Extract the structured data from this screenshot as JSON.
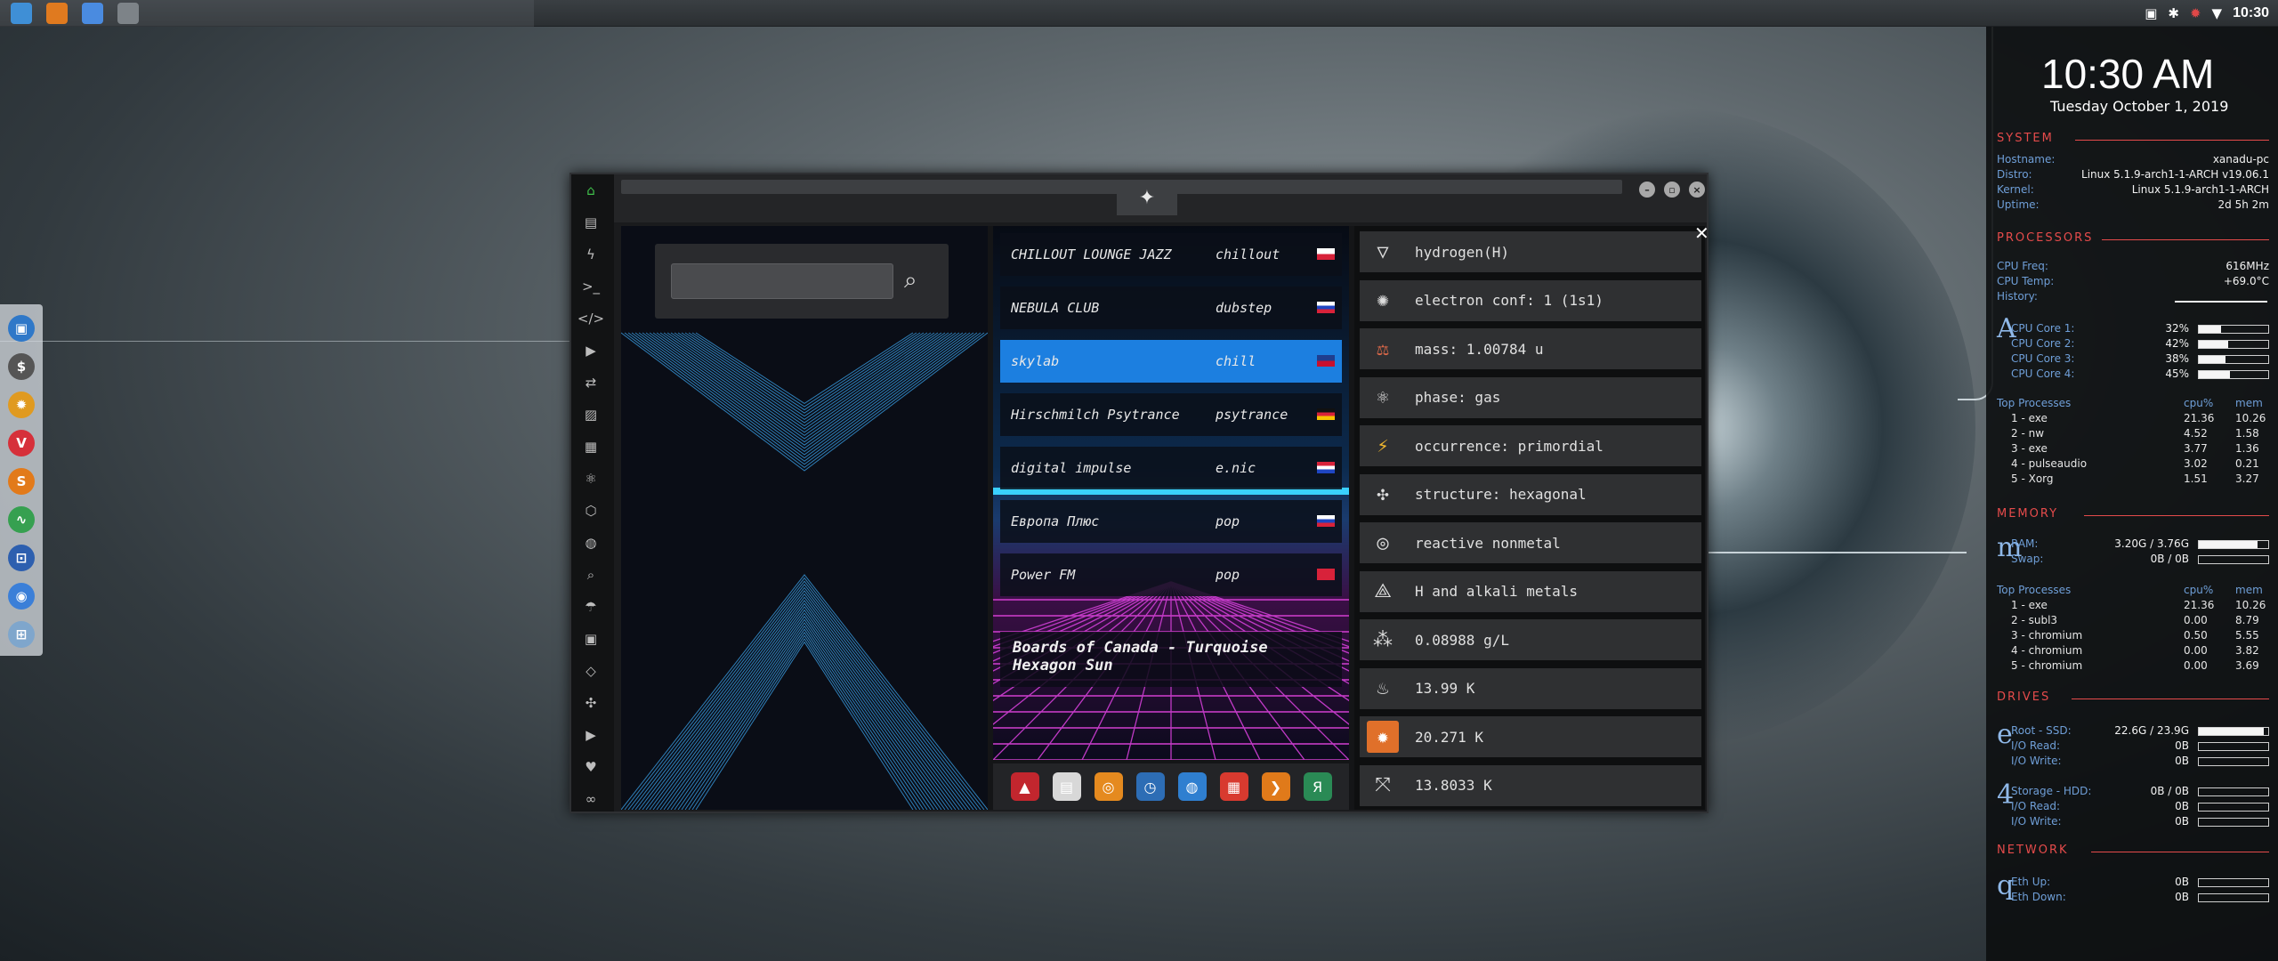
{
  "topbar": {
    "apps": [
      {
        "name": "files-icon",
        "color": "#3f8fd6"
      },
      {
        "name": "sublime-icon",
        "color": "#e07a1f"
      },
      {
        "name": "chromium-icon",
        "color": "#4a8be0"
      },
      {
        "name": "workspace-icon",
        "color": "#7d8388"
      }
    ],
    "clock": "10:30"
  },
  "dock": [
    {
      "name": "files-icon",
      "color": "#2f78c8",
      "glyph": "▣"
    },
    {
      "name": "dollar-terminal-icon",
      "color": "#555",
      "glyph": "$"
    },
    {
      "name": "settings-icon",
      "color": "#e09a20",
      "glyph": "✹"
    },
    {
      "name": "vivaldi-icon",
      "color": "#d6303a",
      "glyph": "V"
    },
    {
      "name": "sublime-icon",
      "color": "#e27a1a",
      "glyph": "S"
    },
    {
      "name": "monitor-icon",
      "color": "#36a050",
      "glyph": "∿"
    },
    {
      "name": "screenshot-icon",
      "color": "#2d5faf",
      "glyph": "⊡"
    },
    {
      "name": "chromium-icon",
      "color": "#3b7fd8",
      "glyph": "◉"
    },
    {
      "name": "grid-icon",
      "color": "#7fa6cc",
      "glyph": "⊞"
    }
  ],
  "window": {
    "title_glyph": "✦",
    "search": {
      "placeholder": "",
      "value": ""
    },
    "sidebar_icons": [
      "home-icon",
      "document-icon",
      "bolt-icon",
      "terminal-icon",
      "code-icon",
      "play-icon",
      "translate-icon",
      "image-icon",
      "news-icon",
      "atom-icon",
      "hexagon-icon",
      "globe-icon",
      "search-icon",
      "umbrella-icon",
      "contact-icon",
      "embed-icon",
      "network-icon",
      "youtube-icon",
      "heart-icon",
      "infinity-icon"
    ],
    "stations": [
      {
        "name": "CHILLOUT LOUNGE JAZZ",
        "genre": "chillout",
        "flag": "pl"
      },
      {
        "name": "NEBULA CLUB",
        "genre": "dubstep",
        "flag": "ru"
      },
      {
        "name": "skylab",
        "genre": "chill",
        "flag": "gb"
      },
      {
        "name": "Hirschmilch Psytrance",
        "genre": "psytrance",
        "flag": "de"
      },
      {
        "name": "digital impulse",
        "genre": "e.nic",
        "flag": "hr"
      },
      {
        "name": "Европа Плюс",
        "genre": "pop",
        "flag": "ru"
      },
      {
        "name": "Power FM",
        "genre": "pop",
        "flag": "tr"
      }
    ],
    "active_station": 2,
    "now_playing": "Boards of Canada - Turquoise Hexagon Sun",
    "appbar": [
      {
        "name": "app-red-icon",
        "color": "#c2262e",
        "glyph": "▲"
      },
      {
        "name": "calendar-notes-icon",
        "color": "#d8d8d8",
        "glyph": "▤"
      },
      {
        "name": "magnifier-app-icon",
        "color": "#e58a1f",
        "glyph": "◎"
      },
      {
        "name": "clock-app-icon",
        "color": "#2d6db5",
        "glyph": "◷"
      },
      {
        "name": "globe-app-icon",
        "color": "#2f7fd0",
        "glyph": "◍"
      },
      {
        "name": "calendar-app-icon",
        "color": "#d83a2f",
        "glyph": "▦"
      },
      {
        "name": "arrow-app-icon",
        "color": "#e07a1a",
        "glyph": "❯"
      },
      {
        "name": "yandex-app-icon",
        "color": "#2a8a55",
        "glyph": "Я"
      }
    ],
    "elements": [
      {
        "icon": "triangle-icon",
        "glyph": "▽",
        "text": "hydrogen(H)"
      },
      {
        "icon": "electron-icon",
        "glyph": "✺",
        "text": "electron conf: 1 (1s1)"
      },
      {
        "icon": "scale-icon",
        "glyph": "⚖",
        "text": "mass: 1.00784 u"
      },
      {
        "icon": "atom-icon",
        "glyph": "⚛",
        "text": "phase: gas"
      },
      {
        "icon": "lightning-icon",
        "glyph": "⚡",
        "text": "occurrence: primordial"
      },
      {
        "icon": "structure-icon",
        "glyph": "✣",
        "text": "structure: hexagonal"
      },
      {
        "icon": "reactive-icon",
        "glyph": "◎",
        "text": "reactive nonmetal"
      },
      {
        "icon": "molecule-icon",
        "glyph": "⟁",
        "text": "H and alkali metals"
      },
      {
        "icon": "density-icon",
        "glyph": "⁂",
        "text": "0.08988 g/L"
      },
      {
        "icon": "melting-icon",
        "glyph": "♨",
        "text": "13.99  K"
      },
      {
        "icon": "boiling-icon",
        "glyph": "✹",
        "text": "20.271  K"
      },
      {
        "icon": "critical-icon",
        "glyph": "⤧",
        "text": "13.8033  K"
      }
    ]
  },
  "conky": {
    "time": "10:30 AM",
    "date": "Tuesday October  1, 2019",
    "system_label": "SYSTEM",
    "system": [
      {
        "k": "Hostname:",
        "v": "xanadu-pc"
      },
      {
        "k": "Distro:",
        "v": "Linux 5.1.9-arch1-1-ARCH v19.06.1"
      },
      {
        "k": "Kernel:",
        "v": "Linux 5.1.9-arch1-1-ARCH"
      },
      {
        "k": "Uptime:",
        "v": "2d 5h 2m"
      }
    ],
    "processors_label": "PROCESSORS",
    "cpu": [
      {
        "k": "CPU Freq:",
        "v": "616MHz"
      },
      {
        "k": "CPU Temp:",
        "v": "+69.0°C"
      },
      {
        "k": "History:",
        "v": ""
      }
    ],
    "cores_glyph": "A",
    "cores": [
      {
        "k": "CPU Core 1:",
        "v": "32%",
        "pct": 32
      },
      {
        "k": "CPU Core 2:",
        "v": "42%",
        "pct": 42
      },
      {
        "k": "CPU Core 3:",
        "v": "38%",
        "pct": 38
      },
      {
        "k": "CPU Core 4:",
        "v": "45%",
        "pct": 45
      }
    ],
    "top_cpu": {
      "header": [
        "Top Processes",
        "cpu%",
        "mem"
      ],
      "rows": [
        [
          "1 - exe",
          "21.36",
          "10.26"
        ],
        [
          "2 - nw",
          "4.52",
          "1.58"
        ],
        [
          "3 - exe",
          "3.77",
          "1.36"
        ],
        [
          "4 - pulseaudio",
          "3.02",
          "0.21"
        ],
        [
          "5 - Xorg",
          "1.51",
          "3.27"
        ]
      ]
    },
    "memory_label": "MEMORY",
    "mem_glyph": "m",
    "memory": [
      {
        "k": "RAM:",
        "v": "3.20G / 3.76G",
        "pct": 85
      },
      {
        "k": "Swap:",
        "v": "0B / 0B",
        "pct": 0
      }
    ],
    "top_mem": {
      "header": [
        "Top Processes",
        "cpu%",
        "mem"
      ],
      "rows": [
        [
          "1 - exe",
          "21.36",
          "10.26"
        ],
        [
          "2 - subl3",
          "0.00",
          "8.79"
        ],
        [
          "3 - chromium",
          "0.50",
          "5.55"
        ],
        [
          "4 - chromium",
          "0.00",
          "3.82"
        ],
        [
          "5 - chromium",
          "0.00",
          "3.69"
        ]
      ]
    },
    "drives_label": "DRIVES",
    "root_glyph": "e",
    "root": [
      {
        "k": "Root - SSD:",
        "v": "22.6G / 23.9G",
        "pct": 94
      },
      {
        "k": "I/O Read:",
        "v": "0B",
        "pct": 0
      },
      {
        "k": "I/O Write:",
        "v": "0B",
        "pct": 0
      }
    ],
    "storage_glyph": "4",
    "storage": [
      {
        "k": "Storage - HDD:",
        "v": "0B / 0B",
        "pct": 0
      },
      {
        "k": "I/O Read:",
        "v": "0B",
        "pct": 0
      },
      {
        "k": "I/O Write:",
        "v": "0B",
        "pct": 0
      }
    ],
    "network_label": "NETWORK",
    "net_glyph": "q",
    "network": [
      {
        "k": "Eth Up:",
        "v": "0B",
        "pct": 0
      },
      {
        "k": "Eth Down:",
        "v": "0B",
        "pct": 0
      }
    ]
  }
}
